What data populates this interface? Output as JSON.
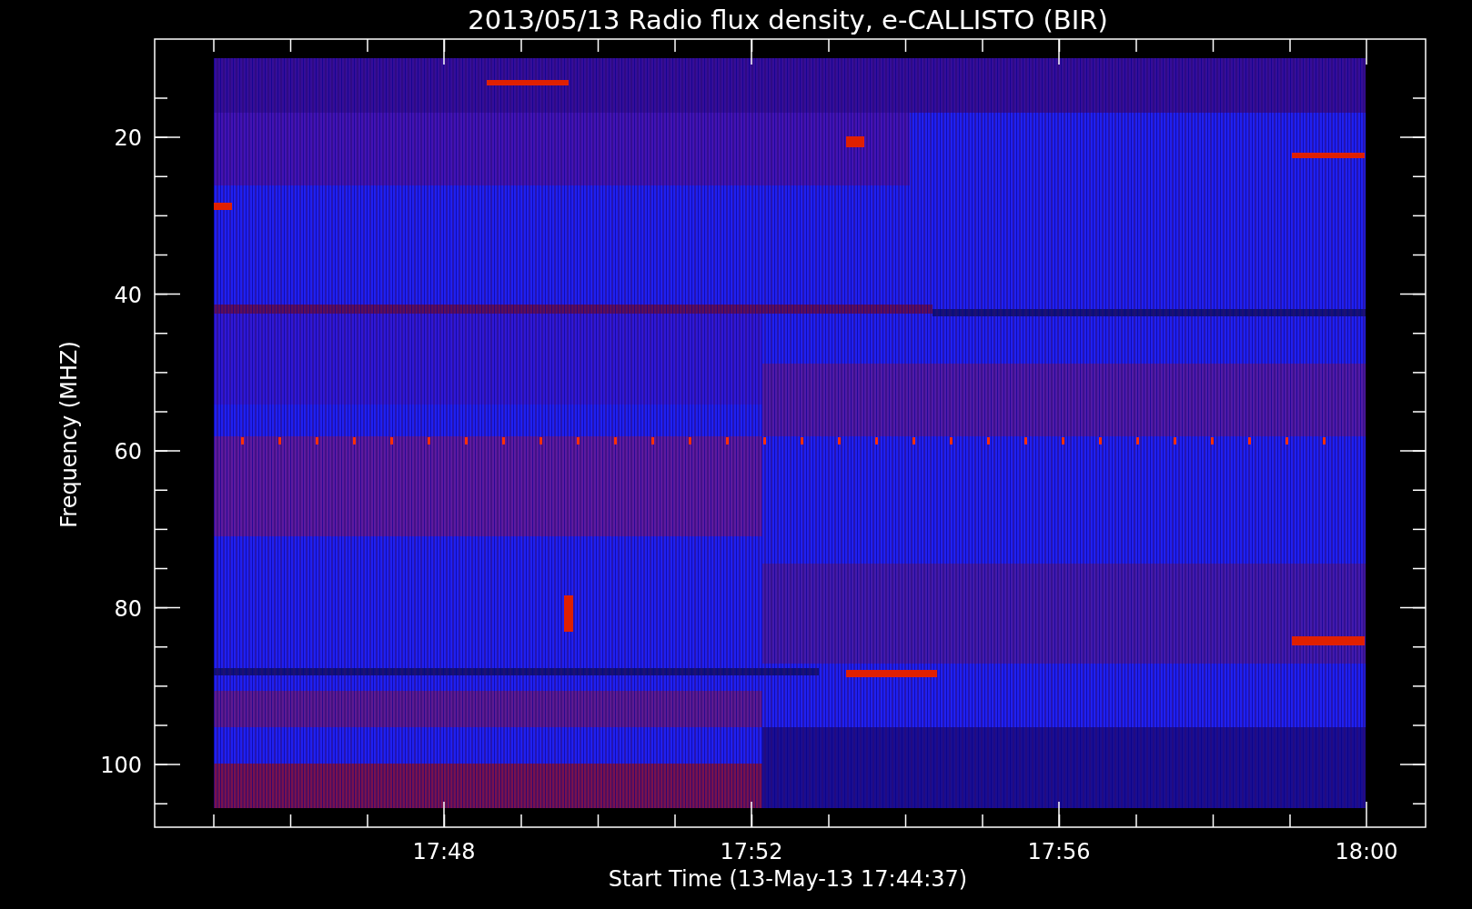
{
  "title": "2013/05/13  Radio flux density, e-CALLISTO (BIR)",
  "y_axis": {
    "label": "Frequency (MHZ)",
    "ticks": [
      "20",
      "40",
      "60",
      "80",
      "100"
    ]
  },
  "x_axis": {
    "label": "Start Time (13-May-13 17:44:37)",
    "ticks": [
      "17:48",
      "17:52",
      "17:56",
      "18:00"
    ]
  }
}
